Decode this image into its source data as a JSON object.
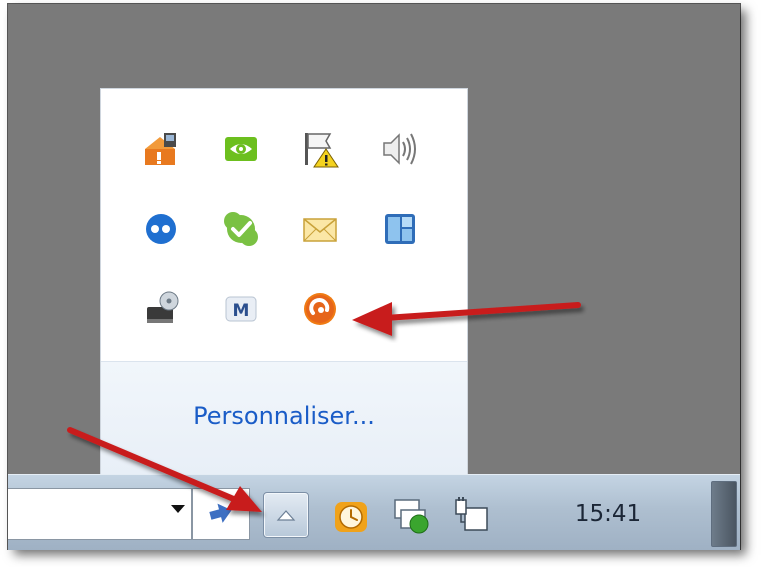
{
  "tray_overflow": {
    "icons": [
      {
        "name": "network-warning-icon"
      },
      {
        "name": "nvidia-icon"
      },
      {
        "name": "action-center-flag-icon"
      },
      {
        "name": "volume-icon"
      },
      {
        "name": "flickr-dots-icon"
      },
      {
        "name": "skype-icon"
      },
      {
        "name": "mail-envelope-icon"
      },
      {
        "name": "window-manager-icon"
      },
      {
        "name": "disk-drive-icon"
      },
      {
        "name": "malwarebytes-icon"
      },
      {
        "name": "avast-icon"
      }
    ],
    "customize_label": "Personnaliser..."
  },
  "taskbar": {
    "clock": "15:41"
  },
  "colors": {
    "annotation_arrow": "#c81e1e",
    "link": "#1a5cc7"
  }
}
